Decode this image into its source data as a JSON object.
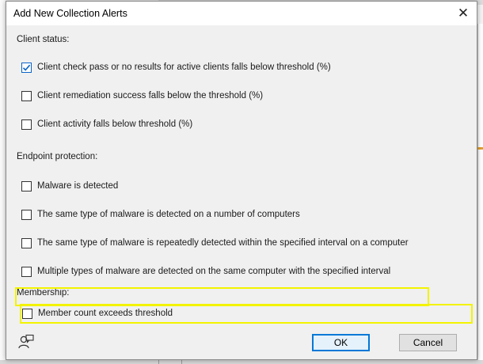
{
  "dialog": {
    "title": "Add New Collection Alerts",
    "close_glyph": "✕"
  },
  "sections": {
    "client_status": "Client status:",
    "endpoint_protection": "Endpoint protection:",
    "membership": "Membership:"
  },
  "options": {
    "client_check": {
      "label": "Client check pass or no results for active clients falls below threshold (%)",
      "checked": true
    },
    "client_remediation": {
      "label": "Client remediation success falls below the threshold (%)",
      "checked": false
    },
    "client_activity": {
      "label": "Client activity falls below threshold (%)",
      "checked": false
    },
    "malware_detected": {
      "label": "Malware is detected",
      "checked": false
    },
    "same_type_multiple": {
      "label": "The same type of malware is detected on a number of computers",
      "checked": false
    },
    "same_type_repeated": {
      "label": "The same type of malware is repeatedly detected within the specified interval on a computer",
      "checked": false
    },
    "multiple_types": {
      "label": "Multiple types of malware are detected on the same computer with the specified interval",
      "checked": false
    },
    "member_count": {
      "label": "Member count exceeds threshold",
      "checked": false
    }
  },
  "buttons": {
    "ok": "OK",
    "cancel": "Cancel"
  },
  "icons": {
    "status": "user-feedback-icon",
    "checkmark": "checkmark-icon"
  },
  "colors": {
    "highlight": "#f3f300",
    "accent": "#0078d7",
    "checkmark": "#0a63c7"
  }
}
